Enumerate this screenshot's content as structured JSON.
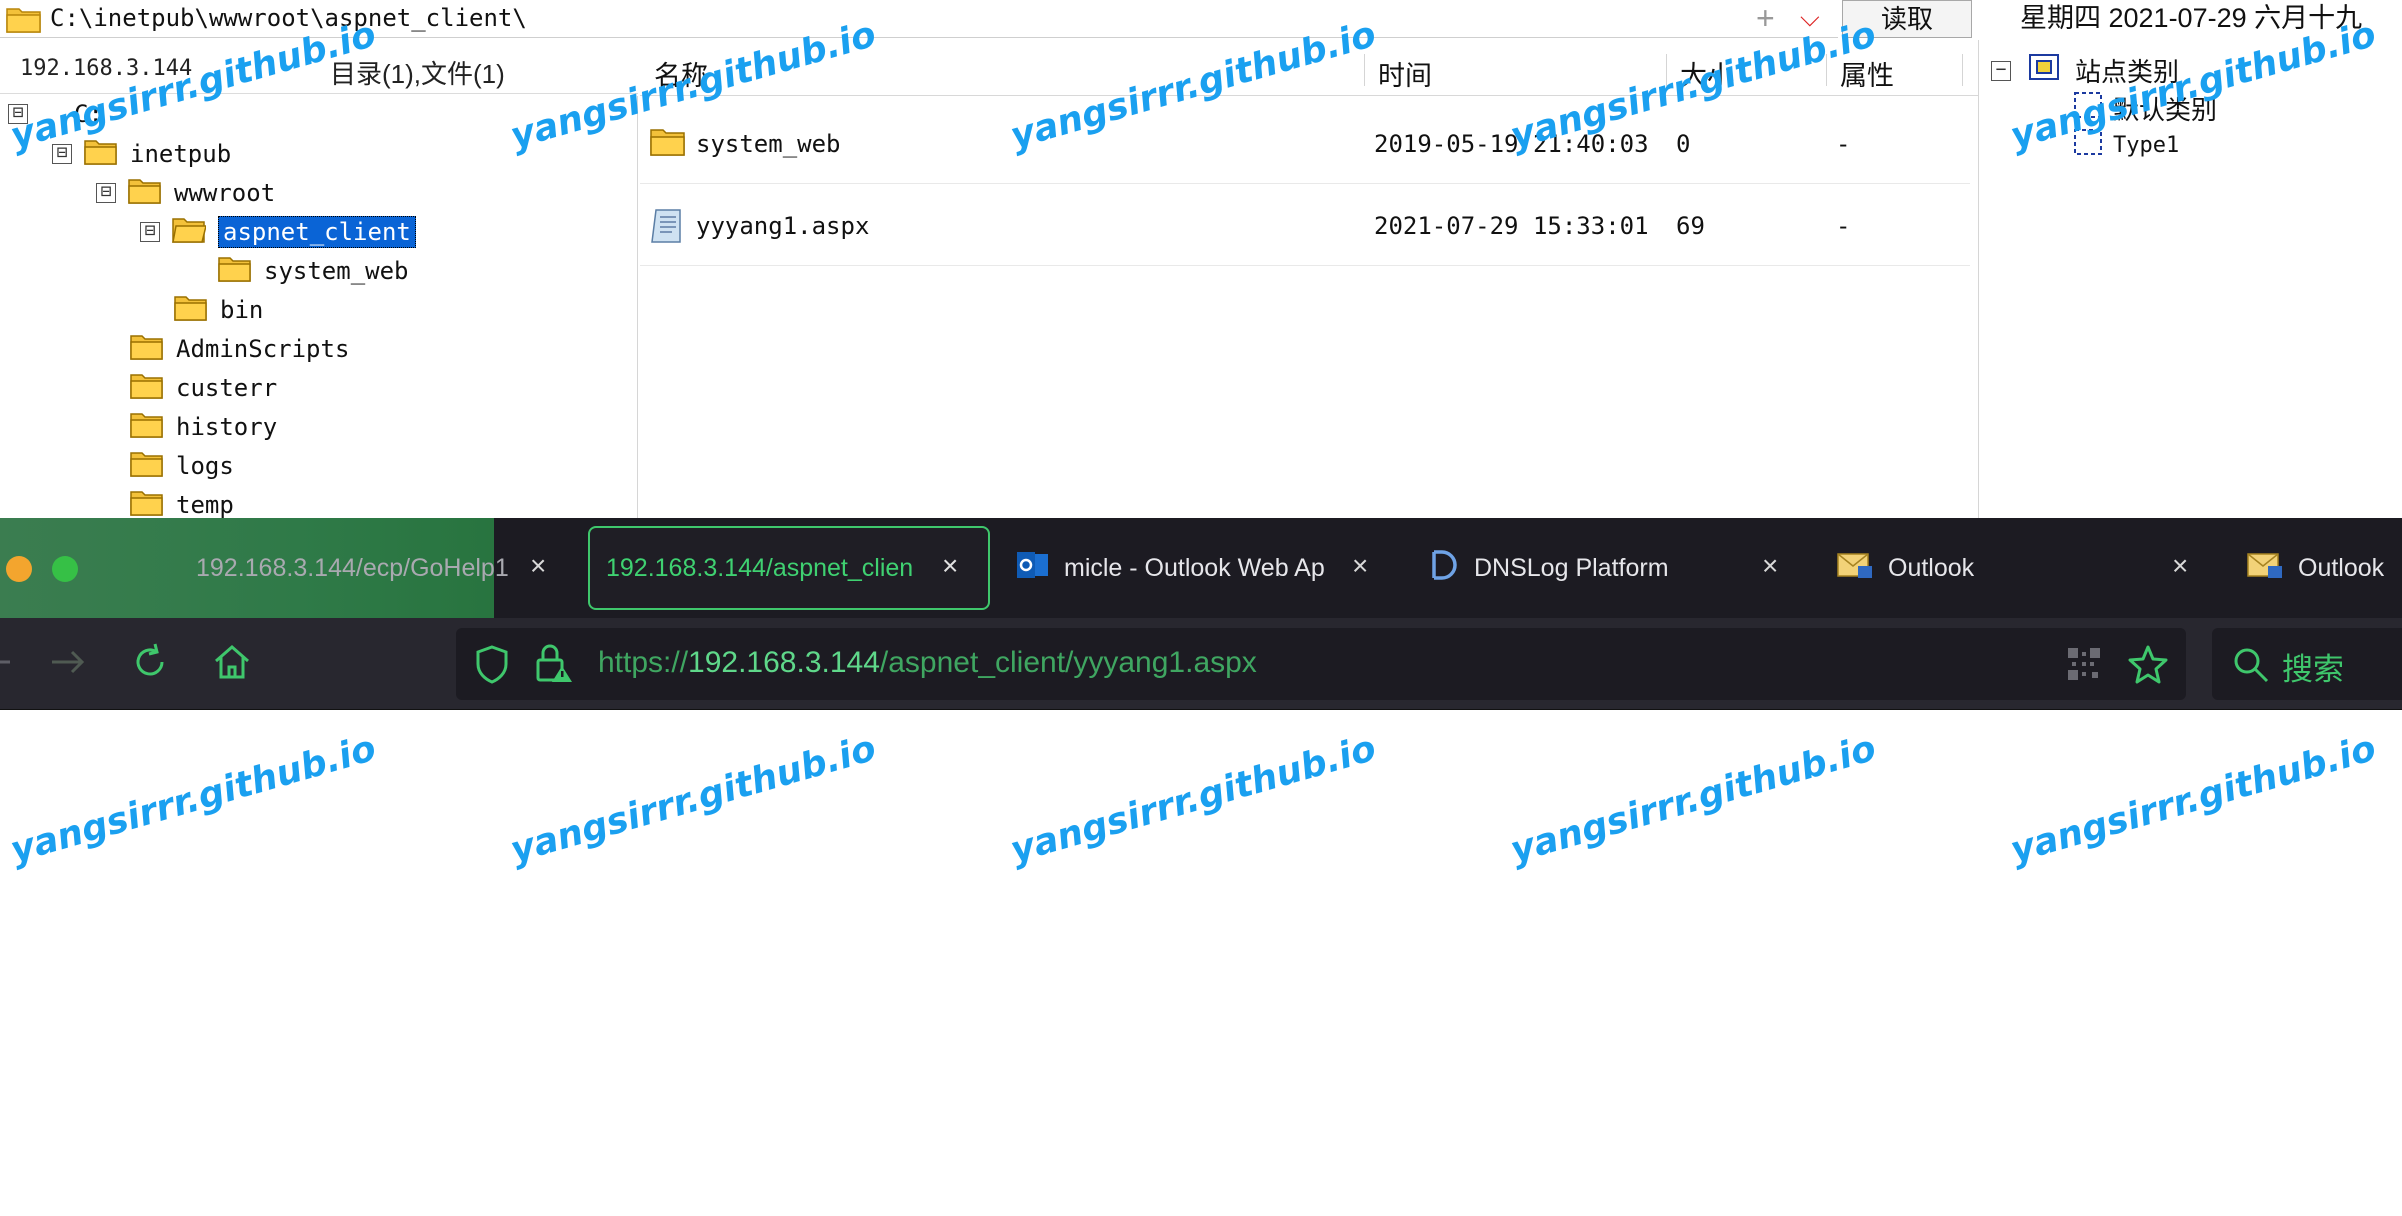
{
  "file_manager": {
    "path": "C:\\inetpub\\wwwroot\\aspnet_client\\",
    "read_button": "读取",
    "date": "星期四 2021-07-29 六月十九",
    "ip": "192.168.3.144",
    "dir_summary": "目录(1),文件(1)",
    "tree": [
      {
        "label": "C:",
        "depth": 0,
        "toggle": "⊟"
      },
      {
        "label": "inetpub",
        "depth": 1,
        "toggle": "⊟"
      },
      {
        "label": "wwwroot",
        "depth": 2,
        "toggle": "⊟"
      },
      {
        "label": "aspnet_client",
        "depth": 3,
        "toggle": "⊟",
        "selected": true
      },
      {
        "label": "system_web",
        "depth": 4
      },
      {
        "label": "bin",
        "depth": 3
      },
      {
        "label": "AdminScripts",
        "depth": 2
      },
      {
        "label": "custerr",
        "depth": 2
      },
      {
        "label": "history",
        "depth": 2
      },
      {
        "label": "logs",
        "depth": 2
      },
      {
        "label": "temp",
        "depth": 2
      }
    ],
    "columns": {
      "name": "名称",
      "time": "时间",
      "size": "大小",
      "attr": "属性"
    },
    "files": [
      {
        "name": "system_web",
        "time": "2019-05-19 21:40:03",
        "size": "0",
        "attr": "-",
        "type": "folder"
      },
      {
        "name": "yyyang1.aspx",
        "time": "2021-07-29 15:33:01",
        "size": "69",
        "attr": "-",
        "type": "file"
      }
    ],
    "site_panel": {
      "root": "站点类别",
      "items": [
        "默认类别",
        "Type1"
      ]
    }
  },
  "browser": {
    "tabs": [
      {
        "title": "192.168.3.144/ecp/GoHelp1",
        "state": "inactive"
      },
      {
        "title": "192.168.3.144/aspnet_clien",
        "state": "active"
      },
      {
        "title": "micle - Outlook Web Ap",
        "icon": "outlook-icon"
      },
      {
        "title": "DNSLog Platform",
        "icon": "dnslog-icon"
      },
      {
        "title": "Outlook",
        "icon": "mail-icon"
      },
      {
        "title": "Outlook",
        "icon": "mail-icon"
      }
    ],
    "url_scheme": "https://",
    "url_host": "192.168.3.144",
    "url_path": "/aspnet_client/yyyang1.aspx",
    "search_label": "搜索"
  },
  "watermark": "yangsirrr.github.io",
  "colors": {
    "accent_green": "#3fc76c",
    "selection_blue": "#0a64d6",
    "watermark_blue": "#1aa0f0",
    "browser_bg": "#1c1b22"
  }
}
